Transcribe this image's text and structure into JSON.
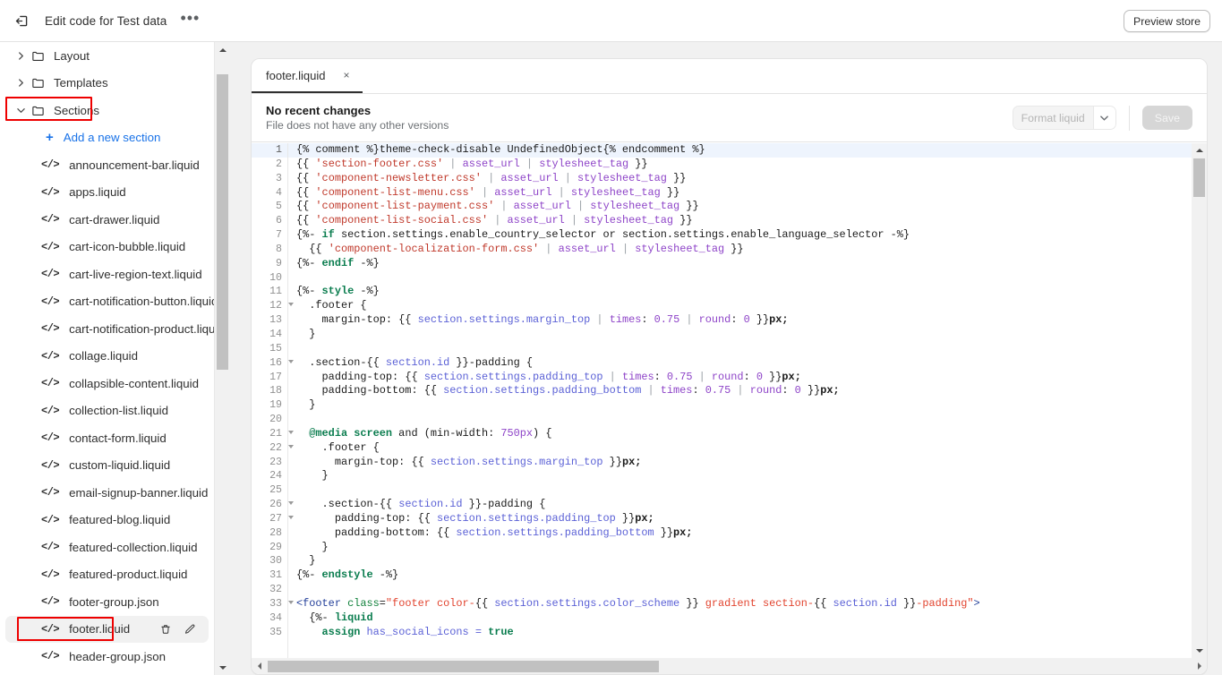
{
  "topbar": {
    "exit_icon": "exit-icon",
    "title": "Edit code for Test data",
    "more_label": "•••",
    "preview_label": "Preview store"
  },
  "sidebar": {
    "items": [
      {
        "type": "folder",
        "label": "Layout",
        "expanded": false,
        "highlight": false
      },
      {
        "type": "folder",
        "label": "Templates",
        "expanded": false,
        "highlight": false
      },
      {
        "type": "folder",
        "label": "Sections",
        "expanded": true,
        "highlight": true
      },
      {
        "type": "add",
        "label": "Add a new section"
      },
      {
        "type": "file",
        "label": "announcement-bar.liquid"
      },
      {
        "type": "file",
        "label": "apps.liquid"
      },
      {
        "type": "file",
        "label": "cart-drawer.liquid"
      },
      {
        "type": "file",
        "label": "cart-icon-bubble.liquid"
      },
      {
        "type": "file",
        "label": "cart-live-region-text.liquid"
      },
      {
        "type": "file",
        "label": "cart-notification-button.liquid"
      },
      {
        "type": "file",
        "label": "cart-notification-product.liquid"
      },
      {
        "type": "file",
        "label": "collage.liquid"
      },
      {
        "type": "file",
        "label": "collapsible-content.liquid"
      },
      {
        "type": "file",
        "label": "collection-list.liquid"
      },
      {
        "type": "file",
        "label": "contact-form.liquid"
      },
      {
        "type": "file",
        "label": "custom-liquid.liquid"
      },
      {
        "type": "file",
        "label": "email-signup-banner.liquid"
      },
      {
        "type": "file",
        "label": "featured-blog.liquid"
      },
      {
        "type": "file",
        "label": "featured-collection.liquid"
      },
      {
        "type": "file",
        "label": "featured-product.liquid"
      },
      {
        "type": "file",
        "label": "footer-group.json"
      },
      {
        "type": "file",
        "label": "footer.liquid",
        "selected": true,
        "highlight": true,
        "actions": [
          "delete-icon",
          "rename-icon"
        ]
      },
      {
        "type": "file",
        "label": "header-group.json"
      }
    ]
  },
  "editor": {
    "tab": {
      "label": "footer.liquid",
      "close": "×"
    },
    "version": {
      "title": "No recent changes",
      "subtitle": "File does not have any other versions"
    },
    "format_label": "Format liquid",
    "format_caret": "⌄",
    "save_label": "Save"
  },
  "code": {
    "active_line": 1,
    "fold_lines": [
      12,
      16,
      21,
      22,
      26,
      27,
      33
    ],
    "lines": [
      {
        "n": 1,
        "tokens": [
          {
            "t": "{% comment %}",
            "c": "t-plain"
          },
          {
            "t": "theme-check-disable UndefinedObject",
            "c": "t-plain"
          },
          {
            "t": "{% endcomment %}",
            "c": "t-plain"
          }
        ]
      },
      {
        "n": 2,
        "tokens": [
          {
            "t": "{{ ",
            "c": "t-plain"
          },
          {
            "t": "'section-footer.css'",
            "c": "t-str"
          },
          {
            "t": " | ",
            "c": "t-pipe"
          },
          {
            "t": "asset_url",
            "c": "t-filter"
          },
          {
            "t": " | ",
            "c": "t-pipe"
          },
          {
            "t": "stylesheet_tag",
            "c": "t-filter"
          },
          {
            "t": " }}",
            "c": "t-plain"
          }
        ]
      },
      {
        "n": 3,
        "tokens": [
          {
            "t": "{{ ",
            "c": "t-plain"
          },
          {
            "t": "'component-newsletter.css'",
            "c": "t-str"
          },
          {
            "t": " | ",
            "c": "t-pipe"
          },
          {
            "t": "asset_url",
            "c": "t-filter"
          },
          {
            "t": " | ",
            "c": "t-pipe"
          },
          {
            "t": "stylesheet_tag",
            "c": "t-filter"
          },
          {
            "t": " }}",
            "c": "t-plain"
          }
        ]
      },
      {
        "n": 4,
        "tokens": [
          {
            "t": "{{ ",
            "c": "t-plain"
          },
          {
            "t": "'component-list-menu.css'",
            "c": "t-str"
          },
          {
            "t": " | ",
            "c": "t-pipe"
          },
          {
            "t": "asset_url",
            "c": "t-filter"
          },
          {
            "t": " | ",
            "c": "t-pipe"
          },
          {
            "t": "stylesheet_tag",
            "c": "t-filter"
          },
          {
            "t": " }}",
            "c": "t-plain"
          }
        ]
      },
      {
        "n": 5,
        "tokens": [
          {
            "t": "{{ ",
            "c": "t-plain"
          },
          {
            "t": "'component-list-payment.css'",
            "c": "t-str"
          },
          {
            "t": " | ",
            "c": "t-pipe"
          },
          {
            "t": "asset_url",
            "c": "t-filter"
          },
          {
            "t": " | ",
            "c": "t-pipe"
          },
          {
            "t": "stylesheet_tag",
            "c": "t-filter"
          },
          {
            "t": " }}",
            "c": "t-plain"
          }
        ]
      },
      {
        "n": 6,
        "tokens": [
          {
            "t": "{{ ",
            "c": "t-plain"
          },
          {
            "t": "'component-list-social.css'",
            "c": "t-str"
          },
          {
            "t": " | ",
            "c": "t-pipe"
          },
          {
            "t": "asset_url",
            "c": "t-filter"
          },
          {
            "t": " | ",
            "c": "t-pipe"
          },
          {
            "t": "stylesheet_tag",
            "c": "t-filter"
          },
          {
            "t": " }}",
            "c": "t-plain"
          }
        ]
      },
      {
        "n": 7,
        "tokens": [
          {
            "t": "{%- ",
            "c": "t-plain"
          },
          {
            "t": "if",
            "c": "t-kw"
          },
          {
            "t": " section.settings.enable_country_selector ",
            "c": "t-plain"
          },
          {
            "t": "or",
            "c": "t-plain"
          },
          {
            "t": " section.settings.enable_language_selector ",
            "c": "t-plain"
          },
          {
            "t": "-%}",
            "c": "t-plain"
          }
        ]
      },
      {
        "n": 8,
        "tokens": [
          {
            "t": "  {{ ",
            "c": "t-plain"
          },
          {
            "t": "'component-localization-form.css'",
            "c": "t-str"
          },
          {
            "t": " | ",
            "c": "t-pipe"
          },
          {
            "t": "asset_url",
            "c": "t-filter"
          },
          {
            "t": " | ",
            "c": "t-pipe"
          },
          {
            "t": "stylesheet_tag",
            "c": "t-filter"
          },
          {
            "t": " }}",
            "c": "t-plain"
          }
        ]
      },
      {
        "n": 9,
        "tokens": [
          {
            "t": "{%- ",
            "c": "t-plain"
          },
          {
            "t": "endif",
            "c": "t-kw"
          },
          {
            "t": " -%}",
            "c": "t-plain"
          }
        ]
      },
      {
        "n": 10,
        "tokens": []
      },
      {
        "n": 11,
        "tokens": [
          {
            "t": "{%- ",
            "c": "t-plain"
          },
          {
            "t": "style",
            "c": "t-kw"
          },
          {
            "t": " -%}",
            "c": "t-plain"
          }
        ]
      },
      {
        "n": 12,
        "tokens": [
          {
            "t": "  .footer {",
            "c": "t-sel"
          }
        ]
      },
      {
        "n": 13,
        "tokens": [
          {
            "t": "    margin-top: ",
            "c": "t-prop"
          },
          {
            "t": "{{ ",
            "c": "t-plain"
          },
          {
            "t": "section.settings.margin_top",
            "c": "t-obj"
          },
          {
            "t": " | ",
            "c": "t-pipe"
          },
          {
            "t": "times",
            "c": "t-filter"
          },
          {
            "t": ": ",
            "c": "t-plain"
          },
          {
            "t": "0.75",
            "c": "t-num"
          },
          {
            "t": " | ",
            "c": "t-pipe"
          },
          {
            "t": "round",
            "c": "t-filter"
          },
          {
            "t": ": ",
            "c": "t-plain"
          },
          {
            "t": "0",
            "c": "t-num"
          },
          {
            "t": " }}",
            "c": "t-plain"
          },
          {
            "t": "px;",
            "c": "t-unit"
          }
        ]
      },
      {
        "n": 14,
        "tokens": [
          {
            "t": "  }",
            "c": "t-plain"
          }
        ]
      },
      {
        "n": 15,
        "tokens": []
      },
      {
        "n": 16,
        "tokens": [
          {
            "t": "  .section-",
            "c": "t-sel"
          },
          {
            "t": "{{ ",
            "c": "t-plain"
          },
          {
            "t": "section.id",
            "c": "t-obj"
          },
          {
            "t": " }}",
            "c": "t-plain"
          },
          {
            "t": "-padding {",
            "c": "t-sel"
          }
        ]
      },
      {
        "n": 17,
        "tokens": [
          {
            "t": "    padding-top: ",
            "c": "t-prop"
          },
          {
            "t": "{{ ",
            "c": "t-plain"
          },
          {
            "t": "section.settings.padding_top",
            "c": "t-obj"
          },
          {
            "t": " | ",
            "c": "t-pipe"
          },
          {
            "t": "times",
            "c": "t-filter"
          },
          {
            "t": ": ",
            "c": "t-plain"
          },
          {
            "t": "0.75",
            "c": "t-num"
          },
          {
            "t": " | ",
            "c": "t-pipe"
          },
          {
            "t": "round",
            "c": "t-filter"
          },
          {
            "t": ": ",
            "c": "t-plain"
          },
          {
            "t": "0",
            "c": "t-num"
          },
          {
            "t": " }}",
            "c": "t-plain"
          },
          {
            "t": "px;",
            "c": "t-unit"
          }
        ]
      },
      {
        "n": 18,
        "tokens": [
          {
            "t": "    padding-bottom: ",
            "c": "t-prop"
          },
          {
            "t": "{{ ",
            "c": "t-plain"
          },
          {
            "t": "section.settings.padding_bottom",
            "c": "t-obj"
          },
          {
            "t": " | ",
            "c": "t-pipe"
          },
          {
            "t": "times",
            "c": "t-filter"
          },
          {
            "t": ": ",
            "c": "t-plain"
          },
          {
            "t": "0.75",
            "c": "t-num"
          },
          {
            "t": " | ",
            "c": "t-pipe"
          },
          {
            "t": "round",
            "c": "t-filter"
          },
          {
            "t": ": ",
            "c": "t-plain"
          },
          {
            "t": "0",
            "c": "t-num"
          },
          {
            "t": " }}",
            "c": "t-plain"
          },
          {
            "t": "px;",
            "c": "t-unit"
          }
        ]
      },
      {
        "n": 19,
        "tokens": [
          {
            "t": "  }",
            "c": "t-plain"
          }
        ]
      },
      {
        "n": 20,
        "tokens": []
      },
      {
        "n": 21,
        "tokens": [
          {
            "t": "  @media screen",
            "c": "t-at"
          },
          {
            "t": " and (min-width: ",
            "c": "t-plain"
          },
          {
            "t": "750px",
            "c": "t-num"
          },
          {
            "t": ") {",
            "c": "t-plain"
          }
        ]
      },
      {
        "n": 22,
        "tokens": [
          {
            "t": "    .footer {",
            "c": "t-sel"
          }
        ]
      },
      {
        "n": 23,
        "tokens": [
          {
            "t": "      margin-top: ",
            "c": "t-prop"
          },
          {
            "t": "{{ ",
            "c": "t-plain"
          },
          {
            "t": "section.settings.margin_top",
            "c": "t-obj"
          },
          {
            "t": " }}",
            "c": "t-plain"
          },
          {
            "t": "px;",
            "c": "t-unit"
          }
        ]
      },
      {
        "n": 24,
        "tokens": [
          {
            "t": "    }",
            "c": "t-plain"
          }
        ]
      },
      {
        "n": 25,
        "tokens": []
      },
      {
        "n": 26,
        "tokens": [
          {
            "t": "    .section-",
            "c": "t-sel"
          },
          {
            "t": "{{ ",
            "c": "t-plain"
          },
          {
            "t": "section.id",
            "c": "t-obj"
          },
          {
            "t": " }}",
            "c": "t-plain"
          },
          {
            "t": "-padding {",
            "c": "t-sel"
          }
        ]
      },
      {
        "n": 27,
        "tokens": [
          {
            "t": "      padding-top: ",
            "c": "t-prop"
          },
          {
            "t": "{{ ",
            "c": "t-plain"
          },
          {
            "t": "section.settings.padding_top",
            "c": "t-obj"
          },
          {
            "t": " }}",
            "c": "t-plain"
          },
          {
            "t": "px;",
            "c": "t-unit"
          }
        ]
      },
      {
        "n": 28,
        "tokens": [
          {
            "t": "      padding-bottom: ",
            "c": "t-prop"
          },
          {
            "t": "{{ ",
            "c": "t-plain"
          },
          {
            "t": "section.settings.padding_bottom",
            "c": "t-obj"
          },
          {
            "t": " }}",
            "c": "t-plain"
          },
          {
            "t": "px;",
            "c": "t-unit"
          }
        ]
      },
      {
        "n": 29,
        "tokens": [
          {
            "t": "    }",
            "c": "t-plain"
          }
        ]
      },
      {
        "n": 30,
        "tokens": [
          {
            "t": "  }",
            "c": "t-plain"
          }
        ]
      },
      {
        "n": 31,
        "tokens": [
          {
            "t": "{%- ",
            "c": "t-plain"
          },
          {
            "t": "endstyle",
            "c": "t-kw"
          },
          {
            "t": " -%}",
            "c": "t-plain"
          }
        ]
      },
      {
        "n": 32,
        "tokens": []
      },
      {
        "n": 33,
        "tokens": [
          {
            "t": "<footer ",
            "c": "t-htmltag"
          },
          {
            "t": "class",
            "c": "t-attr"
          },
          {
            "t": "=",
            "c": "t-plain"
          },
          {
            "t": "\"footer color-",
            "c": "t-attrval"
          },
          {
            "t": "{{ ",
            "c": "t-plain"
          },
          {
            "t": "section.settings.color_scheme",
            "c": "t-obj"
          },
          {
            "t": " }}",
            "c": "t-plain"
          },
          {
            "t": " gradient section-",
            "c": "t-attrval"
          },
          {
            "t": "{{ ",
            "c": "t-plain"
          },
          {
            "t": "section.id",
            "c": "t-obj"
          },
          {
            "t": " }}",
            "c": "t-plain"
          },
          {
            "t": "-padding\"",
            "c": "t-attrval"
          },
          {
            "t": ">",
            "c": "t-htmltag"
          }
        ]
      },
      {
        "n": 34,
        "tokens": [
          {
            "t": "  {%- ",
            "c": "t-plain"
          },
          {
            "t": "liquid",
            "c": "t-kw"
          }
        ]
      },
      {
        "n": 35,
        "tokens": [
          {
            "t": "    ",
            "c": "t-plain"
          },
          {
            "t": "assign",
            "c": "t-kw"
          },
          {
            "t": " has_social_icons = ",
            "c": "t-obj"
          },
          {
            "t": "true",
            "c": "t-kw"
          }
        ]
      }
    ]
  }
}
